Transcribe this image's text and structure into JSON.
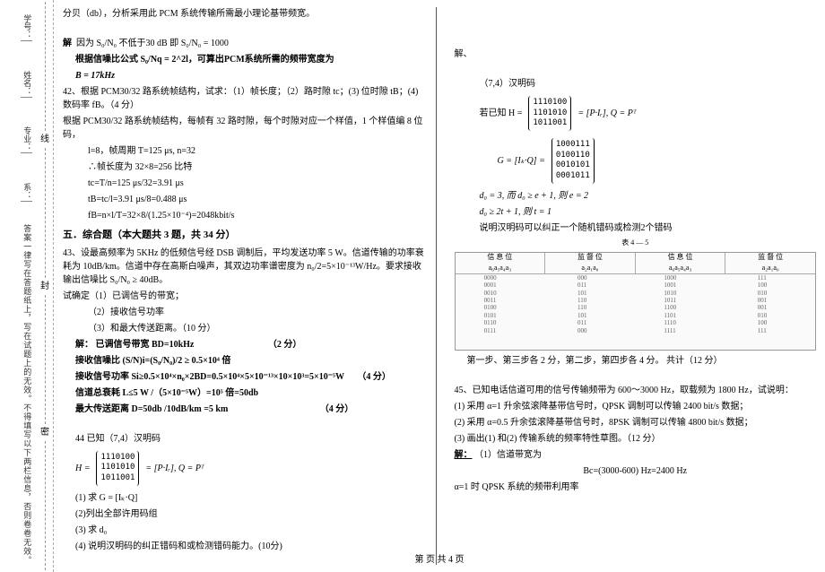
{
  "binding": {
    "labels": [
      "学号：",
      "姓名：",
      "专业：",
      "系："
    ],
    "note": "答案一律写在答题纸上，写在试题上的无效。不得填写以下两栏信息，否则卷卷无效。",
    "seal": [
      "密",
      "封",
      "线"
    ]
  },
  "left": {
    "p1": "分贝（db），分析采用此 PCM 系统传输所需最小理论基带频宽。",
    "p2_label": "解",
    "p2": "因为 S₀/N₀ 不低于30 dB 即 S₀/N₀ = 1000",
    "p3": "根据信噪比公式 S₀/Nq = 2^2l，可算出PCM系统所需的频带宽度为",
    "p4": "B = 17kHz",
    "q42": "42、根据 PCM30/32 路系统帧结构，试求：（1）帧长度；（2）路时隙 tc；(3) 位时隙 tB；(4) 数码率 fB。（4 分）",
    "q42_a1": "根据 PCM30/32 路系统帧结构，每帧有 32 路时隙，每个时隙对应一个样值，1 个样值编 8 位码，",
    "q42_a2": "l=8，帧周期 T=125 μs, n=32",
    "q42_a3": "∴帧长度为 32×8=256 比特",
    "q42_a4": "tc=T/n=125 μs/32=3.91 μs",
    "q42_a5": "tB=tc/l=3.91 μs/8=0.488 μs",
    "q42_a6": "fB=n×l/T=32×8/(1.25×10⁻⁴)=2048kbit/s",
    "section5": "五．综合题（本大题共 3 题，共 34 分）",
    "q43": "43、设最高频率为 5KHz 的低频信号经 DSB 调制后，平均发送功率    5 W。信道传输的功率衰耗为 10dB/km。信道中存在高斯白噪声，其双边功率谱密度为 n₀/2=5×10⁻¹³W/Hz。要求接收输出信噪比 S₀/N₀ ≥ 40dB。",
    "q43_1": "试确定（1）已调信号的带宽；",
    "q43_2": "（2）接收信号功率",
    "q43_3": "（3）和最大传送距离。（10 分）",
    "sol_label": "解：",
    "sol1": "已调信号带宽 BD=10kHz",
    "sol1_pts": "（2 分）",
    "sol2": "接收信噪比 (S/N)i=(S₀/N₀)/2 ≥ 0.5×10⁴ 倍",
    "sol3": "接收信号功率 Si≥0.5×10⁴×n₀×2BD=0.5×10⁴×5×10⁻¹³×10×10³=5×10⁻⁵W",
    "sol3_pts": "（4 分）",
    "sol4": "信道总衰耗 L≤5 W /（5×10⁻⁵W）=10⁵ 倍=50db",
    "sol5": "最大传送距离 D=50db /10dB/km =5 km",
    "sol5_pts": "（4 分）",
    "q44": "44 已知（7,4）汉明码",
    "q44_eq_lhs": "H =",
    "q44_matrix": [
      "1110100",
      "1101010",
      "1011001"
    ],
    "q44_eq_rhs": "= [P·Iᵣ], Q = Pᵀ",
    "q44_1": "(1) 求 G = [Iₖ·Q]",
    "q44_2": "(2)列出全部许用码组",
    "q44_3": "(3) 求 d₀",
    "q44_4": "(4) 说明汉明码的纠正错码和或检测错码能力。(10分)"
  },
  "right": {
    "jie": "解、",
    "r1": "（7,4）汉明码",
    "r2_pre": "若已知 H =",
    "r2_matrix": [
      "1110100",
      "1101010",
      "1011001"
    ],
    "r2_post": "= [P·Iᵣ], Q = Pᵀ",
    "r3_pre": "G = [Iₖ·Q] =",
    "r3_matrix": [
      "1000111",
      "0100110",
      "0010101",
      "0001011"
    ],
    "r4": "d₀ = 3, 而 d₀ ≥ e + 1, 则 e = 2",
    "r5": "d₀ ≥ 2t + 1, 则 t = 1",
    "r6": "说明汉明码可以纠正一个随机错码或检测2个错码",
    "table_caption": "表   4 — 5",
    "table_headers_top": [
      "信 息 位",
      "监 督 位",
      "信 息 位",
      "监 督 位"
    ],
    "table_headers_sub": [
      "a₆a₅a₄a₃",
      "a₂a₁a₀",
      "a₆a₅a₄a₃",
      "a₂a₁a₀"
    ],
    "table_cols": {
      "c1": [
        "0000",
        "0001",
        "0010",
        "0011",
        "0100",
        "0101",
        "0110",
        "0111"
      ],
      "c2": [
        "000",
        "011",
        "101",
        "110",
        "110",
        "101",
        "011",
        "000"
      ],
      "c3": [
        "1000",
        "1001",
        "1010",
        "1011",
        "1100",
        "1101",
        "1110",
        "1111"
      ],
      "c4": [
        "111",
        "100",
        "010",
        "001",
        "001",
        "010",
        "100",
        "111"
      ]
    },
    "step_pts": "第一步、第三步各 2 分，第二步，第四步各 4 分。    共计（12 分）",
    "q45": "45、已知电话信道可用的信号传输频带为 600～3000 Hz，取载频为 1800 Hz，试说明：",
    "q45_1": "(1) 采用 α=1 升余弦滚降基带信号时，QPSK 调制可以传输 2400 bit/s 数据；",
    "q45_2": "(2) 采用 α=0.5 升余弦滚降基带信号时，8PSK 调制可以传输 4800 bit/s 数据；",
    "q45_3": "(3) 画出(1) 和(2) 传输系统的频率特性草图。（12 分）",
    "q45_sol_label": "解：",
    "q45_sol1": "（1）信道带宽为",
    "q45_sol_eq": "Bc=(3000-600) Hz=2400 Hz",
    "q45_sol2": "α=1 时 QPSK 系统的频带利用率"
  },
  "footer": "第   页 共 4 页"
}
